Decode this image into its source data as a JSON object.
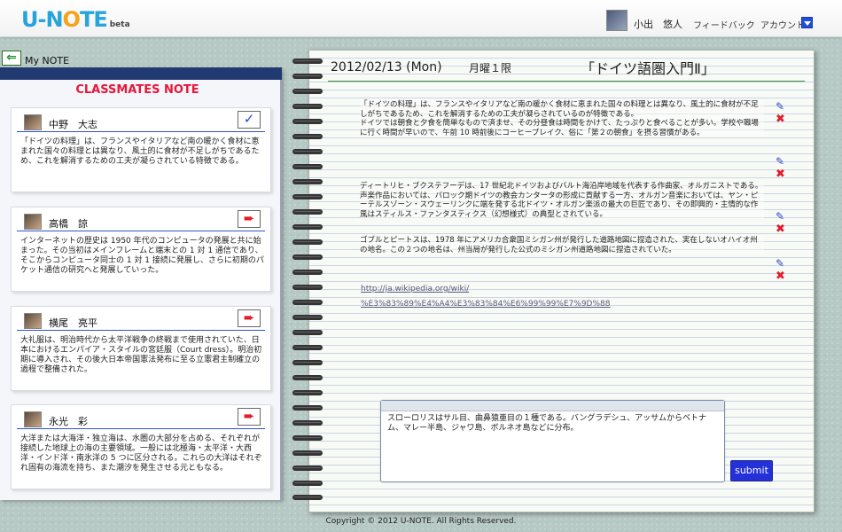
{
  "header": {
    "logo_main": "U-N",
    "logo_o": "O",
    "logo_rest": "TE",
    "logo_beta": "beta",
    "user_name": "小出　悠人",
    "feedback": "フィードバック",
    "account": "アカウント"
  },
  "left": {
    "my_note": "My NOTE",
    "title": "CLASSMATES NOTE",
    "cards": [
      {
        "name": "中野　大志",
        "icon": "check-icon",
        "text": "「ドイツの料理」は、フランスやイタリアなど南の暖かく食材に恵まれた国々の料理とは異なり、風土的に食材が不足しがちであるため、これを解消するための工夫が凝らされている特徴である。"
      },
      {
        "name": "高橋　諒",
        "icon": "arrow-right-icon",
        "text": "インターネットの歴史は 1950 年代のコンピュータの発展と共に始まった。その当初はメインフレームと端末との 1 対 1 通信であり、そこからコンピュータ同士の 1 対 1 接続に発展し、さらに初期のパケット通信の研究へと発展していった。"
      },
      {
        "name": "横尾　亮平",
        "icon": "arrow-right-icon",
        "text": "大礼服は、明治時代から太平洋戦争の終戦まで使用されていた、日本におけるエンパイア・スタイルの宮廷服（Court dress）。明治初期に導入され、その後大日本帝国憲法発布に至る立憲君主制確立の過程で整備された。"
      },
      {
        "name": "永光　彩",
        "icon": "arrow-right-icon",
        "text": "大洋または大海洋・独立海は、水圏の大部分を占める、それぞれが接続した地球上の海の主要領域。一般には北極海・太平洋・大西洋・インド洋・南氷洋の 5 つに区分される。これらの大洋はそれぞれ固有の海流を持ち、また潮汐を発生させる元ともなる。"
      }
    ]
  },
  "notebook": {
    "date": "2012/02/13 (Mon)",
    "period": "月曜１限",
    "course": "「ドイツ語圏入門Ⅱ」",
    "notes": [
      "「ドイツの料理」は、フランスやイタリアなど南の暖かく食材に恵まれた国々の料理とは異なり、風土的に食材が不足しがちであるため、これを解消するための工夫が凝らされているのが特徴である。\nドイツでは朝食と夕食を簡単なもので済ませ、その分昼食は時間をかけて、たっぷりと食べることが多い。学校や職場に行く時間が早いので、午前 10 時前後にコーヒーブレイク、俗に「第２の朝食」を摂る習慣がある。",
      "ディートリヒ・ブクステフーデは、17 世紀北ドイツおよびバルト海沿岸地域を代表する作曲家、オルガニストである。声楽作品においては、バロック期ドイツの教会カンタータの形成に貢献する一方、オルガン音楽においては、ヤン・ピーテルスゾーン・スウェーリンクに端を発する北ドイツ・オルガン楽派の最大の巨匠であり、その即興的・主情的な作風はスティルス・ファンタスティクス（幻想様式）の典型とされている。",
      "ゴブルとピートスは、1978 年にアメリカ合衆国ミシガン州が発行した道路地図に捏造された、実在しないオハイオ州の地名。この２つの地名は、州当局が発行した公式のミシガン州道路地図に捏造されていた。"
    ],
    "link_line1": "http://ja.wikipedia.org/wiki/",
    "link_line2": "%E3%83%89%E4%A4%E3%83%84%E6%99%99%E7%9D%88",
    "input_text": "スローロリスはサル目、曲鼻猿亜目の１種である。バングラデシュ、アッサムからベトナム、マレー半島、ジャワ島、ボルネオ島などに分布。",
    "submit": "submit"
  },
  "footer": "Copyright © 2012 U-NOTE. All Rights Reserved."
}
